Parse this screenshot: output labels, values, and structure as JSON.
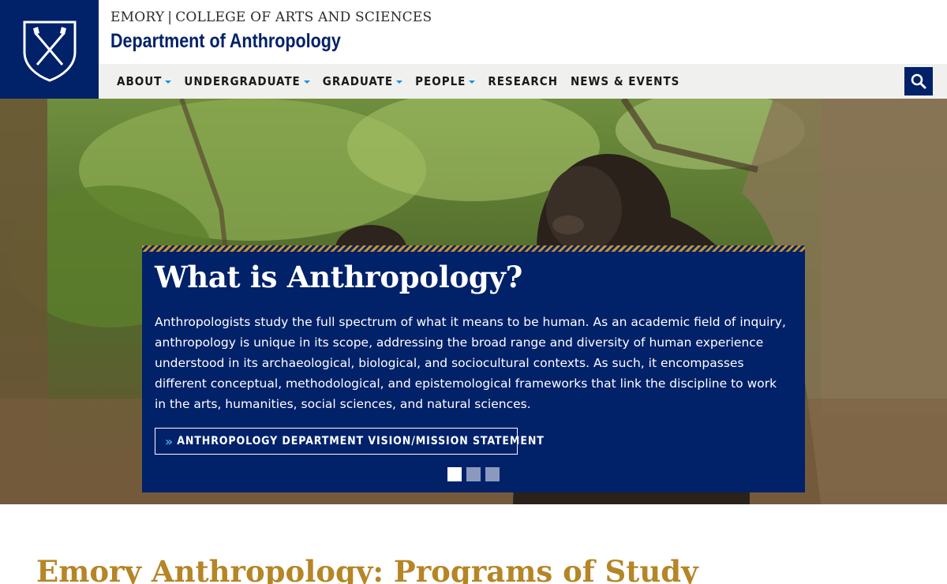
{
  "header": {
    "brand_top_left": "EMORY",
    "brand_top_sep": "|",
    "brand_top_right": "COLLEGE OF ARTS AND SCIENCES",
    "department": "Department of Anthropology",
    "logo_icon": "emory-shield-icon"
  },
  "nav": {
    "items": [
      {
        "label": "ABOUT",
        "has_dropdown": true
      },
      {
        "label": "UNDERGRADUATE",
        "has_dropdown": true
      },
      {
        "label": "GRADUATE",
        "has_dropdown": true
      },
      {
        "label": "PEOPLE",
        "has_dropdown": true
      },
      {
        "label": "RESEARCH",
        "has_dropdown": false
      },
      {
        "label": "NEWS & EVENTS",
        "has_dropdown": false
      }
    ],
    "search_icon": "search-icon"
  },
  "hero": {
    "image": "chimpanzee-in-forest",
    "title": "What is Anthropology?",
    "body": "Anthropologists study the full spectrum of what it means to be human. As an academic field of inquiry, anthropology is unique in its scope, addressing the broad range and diversity of human experience understood in its archaeological, biological, and sociocultural contexts.  As such, it encompasses different conceptual, methodological, and epistemological frameworks that link the discipline to work in the arts, humanities, social sciences, and natural sciences.",
    "cta_icon": "double-chevron-right-icon",
    "cta_label": "ANTHROPOLOGY DEPARTMENT VISION/MISSION STATEMENT",
    "slides_total": 3,
    "active_slide": 1
  },
  "section": {
    "title": "Emory Anthropology: Programs of Study"
  },
  "colors": {
    "navy": "#012169",
    "gold": "#b58526",
    "accent_blue": "#1e8fd8",
    "nav_bg": "#f0f0ef"
  }
}
